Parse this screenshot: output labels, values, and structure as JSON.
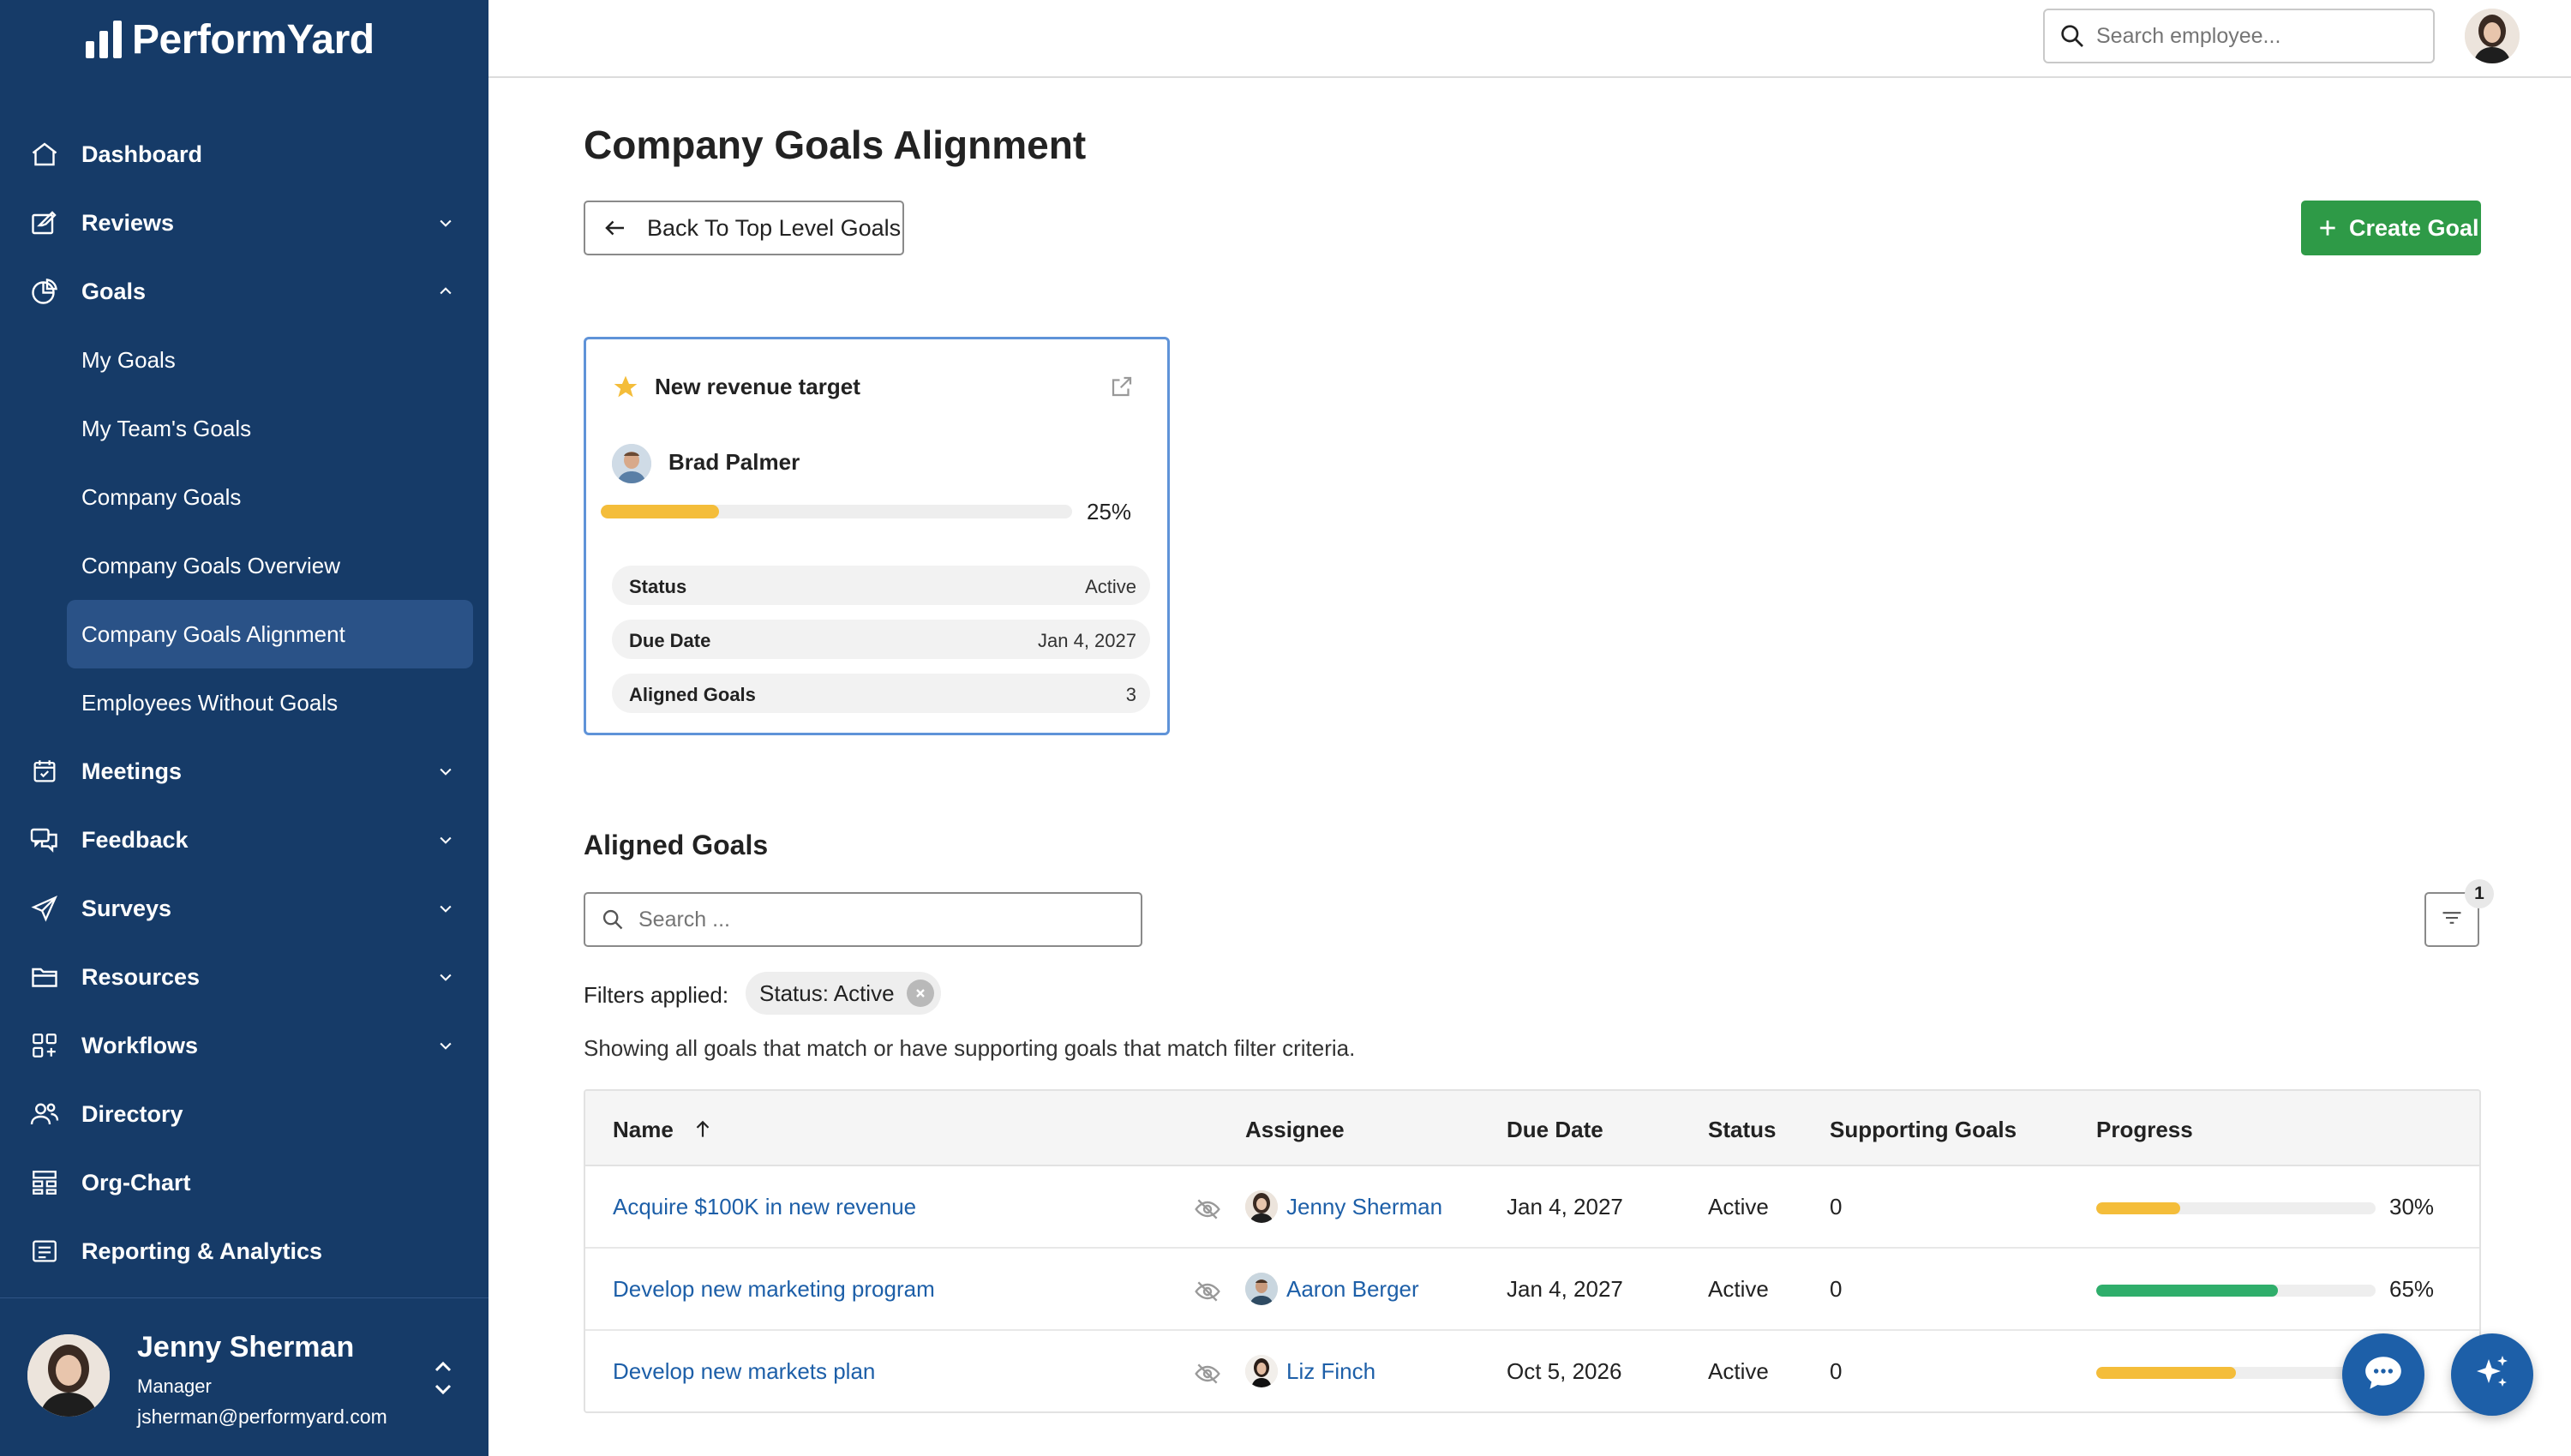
{
  "brand": {
    "name": "PerformYard"
  },
  "nav": {
    "dashboard": "Dashboard",
    "reviews": "Reviews",
    "goals": "Goals",
    "goals_sub": [
      "My Goals",
      "My Team's Goals",
      "Company Goals",
      "Company Goals Overview",
      "Company Goals Alignment",
      "Employees Without Goals"
    ],
    "meetings": "Meetings",
    "feedback": "Feedback",
    "surveys": "Surveys",
    "resources": "Resources",
    "workflows": "Workflows",
    "directory": "Directory",
    "org_chart": "Org-Chart",
    "reporting": "Reporting & Analytics"
  },
  "current_user": {
    "name": "Jenny Sherman",
    "role": "Manager",
    "email": "jsherman@performyard.com"
  },
  "topbar": {
    "search_placeholder": "Search employee..."
  },
  "page": {
    "title": "Company Goals Alignment",
    "back_label": "Back To Top Level Goals",
    "create_label": "Create Goal"
  },
  "goal_card": {
    "title": "New revenue target",
    "owner": "Brad Palmer",
    "progress": 25,
    "progress_label": "25%",
    "rows": [
      {
        "key": "Status",
        "value": "Active"
      },
      {
        "key": "Due Date",
        "value": "Jan 4, 2027"
      },
      {
        "key": "Aligned Goals",
        "value": "3"
      }
    ]
  },
  "aligned": {
    "title": "Aligned Goals",
    "search_placeholder": "Search ...",
    "filter_count": "1",
    "filters_label": "Filters applied:",
    "filter_chip": "Status: Active",
    "showing_text": "Showing all goals that match or have supporting goals that match filter criteria.",
    "columns": {
      "name": "Name",
      "assignee": "Assignee",
      "due_date": "Due Date",
      "status": "Status",
      "supporting": "Supporting Goals",
      "progress": "Progress"
    },
    "rows": [
      {
        "name": "Acquire $100K in new revenue",
        "assignee": "Jenny Sherman",
        "due": "Jan 4, 2027",
        "status": "Active",
        "supporting": "0",
        "progress": 30,
        "progress_label": "30%",
        "color": "#f4bd3a"
      },
      {
        "name": "Develop new marketing program",
        "assignee": "Aaron Berger",
        "due": "Jan 4, 2027",
        "status": "Active",
        "supporting": "0",
        "progress": 65,
        "progress_label": "65%",
        "color": "#2fae6b"
      },
      {
        "name": "Develop new markets plan",
        "assignee": "Liz Finch",
        "due": "Oct 5, 2026",
        "status": "Active",
        "supporting": "0",
        "progress": 50,
        "progress_label": "%",
        "color": "#f4bd3a"
      }
    ]
  },
  "colors": {
    "sidebar": "#163b68",
    "accent_blue": "#1d5fa8",
    "create_green": "#2e9a47",
    "progress_yellow": "#f4bd3a",
    "progress_green": "#2fae6b",
    "card_border": "#5f93d8"
  }
}
